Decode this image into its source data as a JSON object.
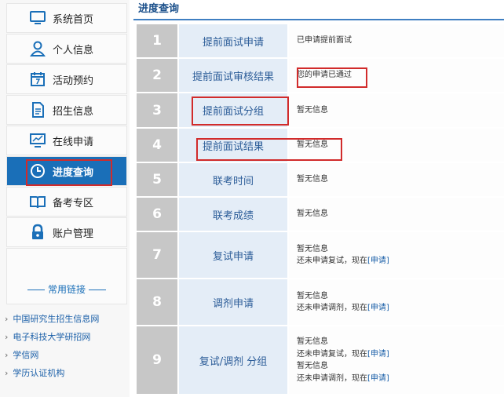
{
  "sidebar": {
    "nav": [
      {
        "label": "系统首页",
        "icon": "monitor-icon"
      },
      {
        "label": "个人信息",
        "icon": "user-icon"
      },
      {
        "label": "活动预约",
        "icon": "calendar-icon"
      },
      {
        "label": "招生信息",
        "icon": "document-icon"
      },
      {
        "label": "在线申请",
        "icon": "screen-chart-icon"
      },
      {
        "label": "进度查询",
        "icon": "clock-icon",
        "active": true
      },
      {
        "label": "备考专区",
        "icon": "book-icon"
      },
      {
        "label": "账户管理",
        "icon": "lock-icon"
      }
    ],
    "links_title": "常用链接",
    "links": [
      "中国研究生招生信息网",
      "电子科技大学研招网",
      "学信网",
      "学历认证机构"
    ]
  },
  "main": {
    "title": "进度查询",
    "steps": [
      {
        "num": "1",
        "name": "提前面试申请",
        "lines": [
          "已申请提前面试"
        ]
      },
      {
        "num": "2",
        "name": "提前面试审核结果",
        "lines": [
          "您的申请已通过"
        ]
      },
      {
        "num": "3",
        "name": "提前面试分组",
        "lines": [
          "暂无信息"
        ]
      },
      {
        "num": "4",
        "name": "提前面试结果",
        "lines": [
          "暂无信息"
        ]
      },
      {
        "num": "5",
        "name": "联考时间",
        "lines": [
          "暂无信息"
        ]
      },
      {
        "num": "6",
        "name": "联考成绩",
        "lines": [
          "暂无信息"
        ]
      },
      {
        "num": "7",
        "name": "复试申请",
        "lines": [
          "暂无信息",
          "还未申请复试，现在"
        ],
        "link": "[申请]"
      },
      {
        "num": "8",
        "name": "调剂申请",
        "lines": [
          "暂无信息",
          "还未申请调剂，现在"
        ],
        "link": "[申请]"
      },
      {
        "num": "9",
        "name": "复试/调剂 分组",
        "lines": [
          "暂无信息",
          "还未申请复试，现在",
          "暂无信息",
          "还未申请调剂，现在"
        ],
        "link": "[申请]"
      }
    ]
  },
  "colors": {
    "accent": "#1a6fb8",
    "highlight": "#d12b2b",
    "num_bg": "#c7c7c7",
    "name_bg": "#e4edf7"
  }
}
